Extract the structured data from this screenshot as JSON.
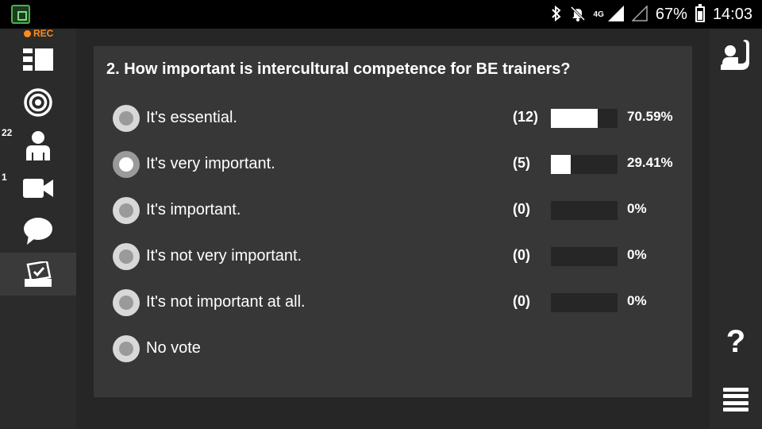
{
  "status_bar": {
    "network": "4G",
    "battery": "67%",
    "battery_level": 0.67,
    "time": "14:03",
    "icons": [
      "app-icon",
      "bluetooth-icon",
      "mute-notifications-icon",
      "signal-icon",
      "signal-empty-icon",
      "battery-icon"
    ]
  },
  "left_sidebar": {
    "rec_label": "REC",
    "rec_color": "#ff8c1a",
    "items": [
      {
        "name": "layout-icon"
      },
      {
        "name": "target-icon"
      },
      {
        "name": "participants-icon",
        "badge": "22"
      },
      {
        "name": "camera-icon",
        "badge": "1"
      },
      {
        "name": "chat-icon"
      },
      {
        "name": "poll-icon",
        "active": true
      }
    ]
  },
  "poll": {
    "question": "2. How important is intercultural competence for BE trainers?",
    "options": [
      {
        "label": "It's essential.",
        "count": "(12)",
        "percent": "70.59%",
        "fraction": 0.7059
      },
      {
        "label": "It's very important.",
        "count": "(5)",
        "percent": "29.41%",
        "fraction": 0.2941,
        "selected": true
      },
      {
        "label": "It's important.",
        "count": "(0)",
        "percent": "0%",
        "fraction": 0
      },
      {
        "label": "It's not very important.",
        "count": "(0)",
        "percent": "0%",
        "fraction": 0
      },
      {
        "label": "It's not important at all.",
        "count": "(0)",
        "percent": "0%",
        "fraction": 0
      },
      {
        "label": "No vote"
      }
    ]
  },
  "right_sidebar": {
    "help_label": "?",
    "icons": [
      "raise-hand-icon",
      "help-icon",
      "menu-icon"
    ]
  }
}
